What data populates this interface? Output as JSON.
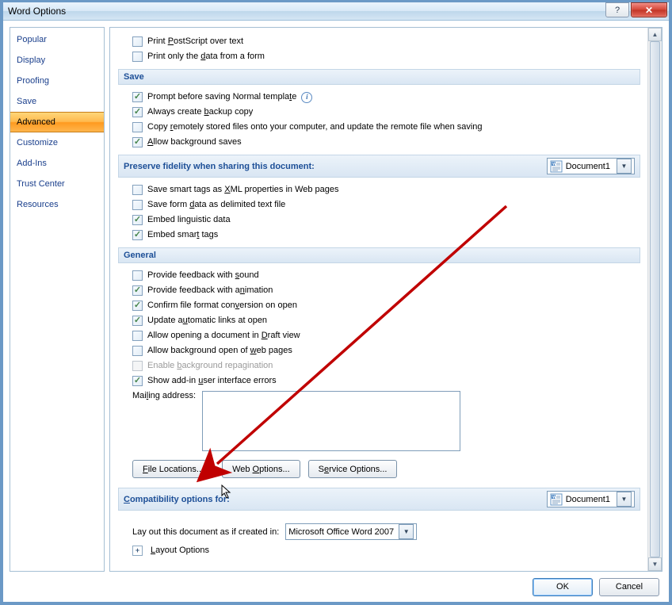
{
  "window": {
    "title": "Word Options",
    "help_label": "?",
    "close_label": "✕"
  },
  "sidebar": {
    "items": [
      {
        "label": "Popular"
      },
      {
        "label": "Display"
      },
      {
        "label": "Proofing"
      },
      {
        "label": "Save"
      },
      {
        "label": "Advanced",
        "selected": true
      },
      {
        "label": "Customize"
      },
      {
        "label": "Add-Ins"
      },
      {
        "label": "Trust Center"
      },
      {
        "label": "Resources"
      }
    ]
  },
  "print_section": {
    "print_postscript": "Print PostScript over text",
    "print_only_data": "Print only the data from a form"
  },
  "save_section": {
    "header": "Save",
    "prompt_normal": "Prompt before saving Normal template",
    "always_backup": "Always create backup copy",
    "copy_remote": "Copy remotely stored files onto your computer, and update the remote file when saving",
    "allow_bg_saves": "Allow background saves"
  },
  "preserve_section": {
    "header": "Preserve fidelity when sharing this document:",
    "document": "Document1",
    "save_smart_tags_xml": "Save smart tags as XML properties in Web pages",
    "save_form_data": "Save form data as delimited text file",
    "embed_linguistic": "Embed linguistic data",
    "embed_smart_tags": "Embed smart tags"
  },
  "general_section": {
    "header": "General",
    "feedback_sound": "Provide feedback with sound",
    "feedback_animation": "Provide feedback with animation",
    "confirm_conversion": "Confirm file format conversion on open",
    "update_auto_links": "Update automatic links at open",
    "allow_draft": "Allow opening a document in Draft view",
    "allow_bg_open_web": "Allow background open of web pages",
    "enable_bg_repag": "Enable background repagination",
    "show_addin_errors": "Show add-in user interface errors",
    "mailing_label": "Mailing address:",
    "mailing_value": "",
    "file_locations_btn": "File Locations...",
    "web_options_btn": "Web Options...",
    "service_options_btn": "Service Options..."
  },
  "compat_section": {
    "header": "Compatibility options for:",
    "document": "Document1",
    "layout_label": "Lay out this document as if created in:",
    "layout_value": "Microsoft Office Word 2007",
    "layout_options": "Layout Options"
  },
  "footer": {
    "ok": "OK",
    "cancel": "Cancel"
  }
}
